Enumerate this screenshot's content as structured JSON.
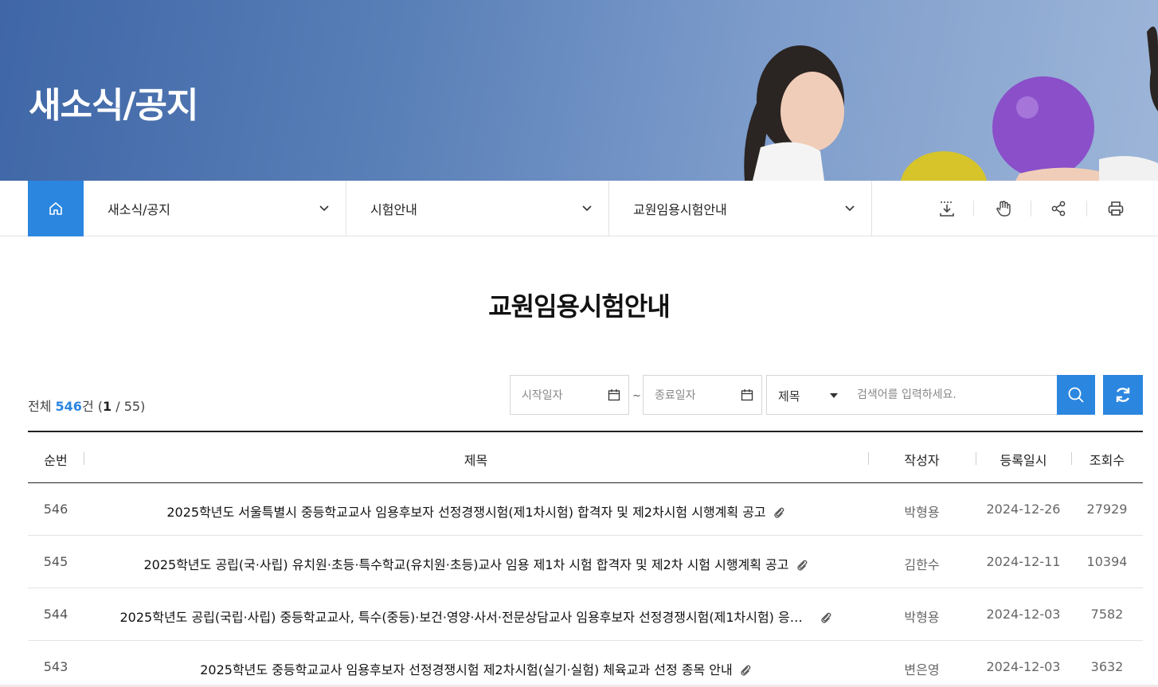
{
  "hero": {
    "title": "새소식/공지"
  },
  "nav": {
    "home_icon": "home-icon",
    "dropdowns": [
      {
        "label": "새소식/공지"
      },
      {
        "label": "시험안내"
      },
      {
        "label": "교원임용시험안내"
      }
    ],
    "tools": [
      "download-icon",
      "touch-hand-icon",
      "share-icon",
      "print-icon"
    ]
  },
  "page": {
    "title": "교원임용시험안내"
  },
  "count": {
    "prefix": "전체 ",
    "total": "546",
    "unit": "건 (",
    "current": "1",
    "suffix": " / 55)"
  },
  "search": {
    "start_date_placeholder": "시작일자",
    "end_date_placeholder": "종료일자",
    "tilde": "~",
    "select_value": "제목",
    "keyword_placeholder": "검색어를 입력하세요."
  },
  "table": {
    "headers": {
      "num": "순번",
      "title": "제목",
      "author": "작성자",
      "date": "등록일시",
      "views": "조회수"
    },
    "rows": [
      {
        "num": "546",
        "title": "2025학년도 서울특별시 중등학교교사 임용후보자 선정경쟁시험(제1차시험) 합격자 및 제2차시험 시행계획 공고",
        "author": "박형용",
        "date": "2024-12-26",
        "views": "27929"
      },
      {
        "num": "545",
        "title": "2025학년도 공립(국·사립) 유치원·초등·특수학교(유치원·초등)교사 임용 제1차 시험 합격자 및 제2차 시험 시행계획 공고",
        "author": "김한수",
        "date": "2024-12-11",
        "views": "10394"
      },
      {
        "num": "544",
        "title": "2025학년도 공립(국립·사립) 중등학교교사, 특수(중등)·보건·영양·사서·전문상담교사 임용후보자 선정경쟁시험(제1차시험) 응시...",
        "author": "박형용",
        "date": "2024-12-03",
        "views": "7582"
      },
      {
        "num": "543",
        "title": "2025학년도 중등학교교사 임용후보자 선정경쟁시험 제2차시험(실기·실험) 체육교과 선정 종목 안내",
        "author": "변은영",
        "date": "2024-12-03",
        "views": "3632"
      }
    ]
  },
  "colors": {
    "accent": "#2b86e0",
    "hero_sky": "#5a80b8"
  }
}
